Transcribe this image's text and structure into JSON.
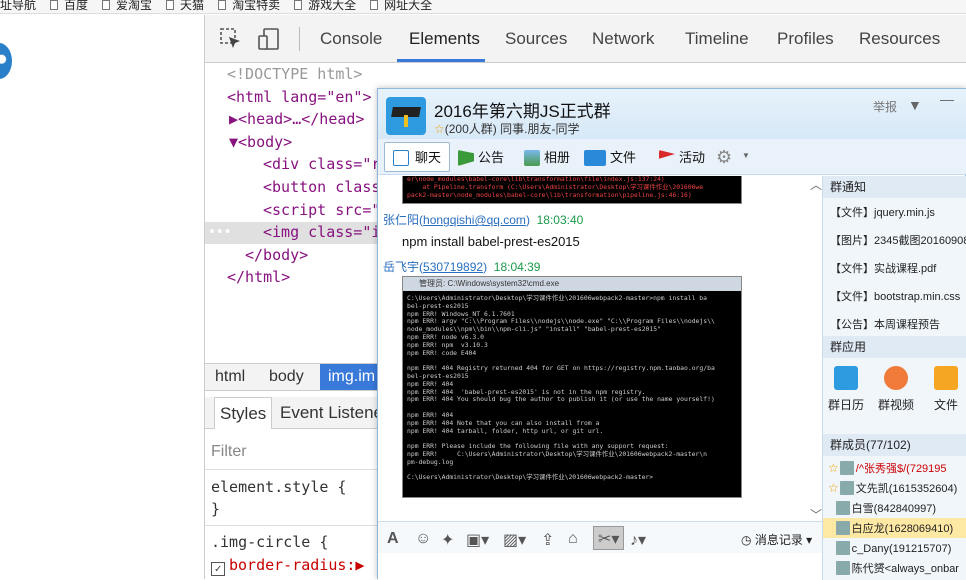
{
  "bookmarks": [
    "址导航",
    "百度",
    "爱淘宝",
    "天猫",
    "淘宝特卖",
    "游戏大全",
    "网址大全"
  ],
  "devtools": {
    "tabs": [
      "Console",
      "Elements",
      "Sources",
      "Network",
      "Timeline",
      "Profiles",
      "Resources"
    ],
    "active_tab": "Elements",
    "code_lines": [
      {
        "indent": 0,
        "text": "<!DOCTYPE html>",
        "kind": "doctype"
      },
      {
        "indent": 0,
        "text": "<html lang=\"en\">",
        "kind": "tag"
      },
      {
        "indent": 1,
        "text": "▶<head>…</head>",
        "kind": "tag"
      },
      {
        "indent": 1,
        "text": "▼<body>",
        "kind": "tag"
      },
      {
        "indent": 2,
        "text": "<div class=\"r",
        "kind": "tag"
      },
      {
        "indent": 2,
        "text": "<button class",
        "kind": "tag"
      },
      {
        "indent": 2,
        "text": "<script src=\"",
        "kind": "tag"
      },
      {
        "indent": 2,
        "text": "<img class=\"i",
        "kind": "tag"
      },
      {
        "indent": 1,
        "text": "</body>",
        "kind": "tag"
      },
      {
        "indent": 0,
        "text": "</html>",
        "kind": "tag"
      }
    ],
    "selected_dots": "•••",
    "breadcrumbs": [
      "html",
      "body",
      "img.im"
    ],
    "styles_tabs": [
      "Styles",
      "Event Listene"
    ],
    "filter_placeholder": "Filter",
    "rules": {
      "element_style": "element.style {",
      "element_close": "}",
      "img_circle": ".img-circle {",
      "border_radius": "border-radius:▶"
    }
  },
  "qq": {
    "group_name": "2016年第六期JS正式群",
    "group_sub": "(200人群) 同事.朋友-同学",
    "report": "举报",
    "tabs": [
      "聊天",
      "公告",
      "相册",
      "文件",
      "活动"
    ],
    "messages": [
      {
        "name": "张仁阳",
        "account": "hongqishi@qq.com",
        "time": "18:03:40",
        "text": "npm install babel-prest-es2015"
      },
      {
        "name": "岳飞宇",
        "account": "530719892",
        "time": "18:04:39"
      }
    ],
    "cmd_title": "管理员: C:\\Windows\\system32\\cmd.exe",
    "cmd_lines": [
      "C:\\Users\\Administrator\\Desktop\\学习课件作业\\201606webpack2-master>npm install ba",
      "bel-prest-es2015",
      "npm ERR! Windows_NT 6.1.7601",
      "npm ERR! argv \"C:\\\\Program Files\\\\nodejs\\\\node.exe\" \"C:\\\\Program Files\\\\nodejs\\\\",
      "node_modules\\\\npm\\\\bin\\\\npm-cli.js\" \"install\" \"babel-prest-es2015\"",
      "npm ERR! node v6.3.0",
      "npm ERR! npm  v3.10.3",
      "npm ERR! code E404",
      "",
      "npm ERR! 404 Registry returned 404 for GET on https://registry.npm.taobao.org/ba",
      "bel-prest-es2015",
      "npm ERR! 404",
      "npm ERR! 404  'babel-prest-es2015' is not in the npm registry.",
      "npm ERR! 404 You should bug the author to publish it (or use the name yourself!)",
      "",
      "npm ERR! 404",
      "npm ERR! 404 Note that you can also install from a",
      "npm ERR! 404 tarball, folder, http url, or git url.",
      "",
      "npm ERR! Please include the following file with any support request:",
      "npm ERR!     C:\\Users\\Administrator\\Desktop\\学习课件作业\\201606webpack2-master\\n",
      "pm-debug.log",
      "",
      "C:\\Users\\Administrator\\Desktop\\学习课件作业\\201606webpack2-master>"
    ],
    "top_shot_lines": [
      "er\\node_modules\\babel-core\\lib\\transformation\\file\\index.js:137:24)",
      "    at Pipeline.transform (C:\\Users\\Administrator\\Desktop\\学习课件作业\\201606we",
      "pack2-master\\node_modules\\babel-core\\lib\\transformation\\pipeline.js:46:16)"
    ],
    "history_label": "消息记录",
    "side": {
      "notice_header": "群通知",
      "files": [
        "【文件】jquery.min.js",
        "【图片】2345截图20160908",
        "【文件】实战课程.pdf",
        "【文件】bootstrap.min.css",
        "【公告】本周课程预告"
      ],
      "apps_header": "群应用",
      "apps": [
        "群日历",
        "群视频",
        "文件"
      ],
      "members_header": "群成员(77/102)",
      "members": [
        {
          "name": "/^张秀强$/(729195",
          "crown": true,
          "selected": false
        },
        {
          "name": "文先凯(1615352604)",
          "crown": true,
          "selected": false
        },
        {
          "name": "白雪(842840997)",
          "crown": false,
          "selected": false
        },
        {
          "name": "白应龙(1628069410)",
          "crown": false,
          "selected": true
        },
        {
          "name": "c_Dany(191215707)",
          "crown": false,
          "selected": false
        },
        {
          "name": "陈代赟<always_onbar",
          "crown": false,
          "selected": false
        }
      ]
    }
  },
  "colors": {
    "accent": "#3879d9",
    "tag": "#881280",
    "attr": "#994500",
    "qq_border": "#8fb8dc",
    "selected_member": "#fde9a4"
  }
}
